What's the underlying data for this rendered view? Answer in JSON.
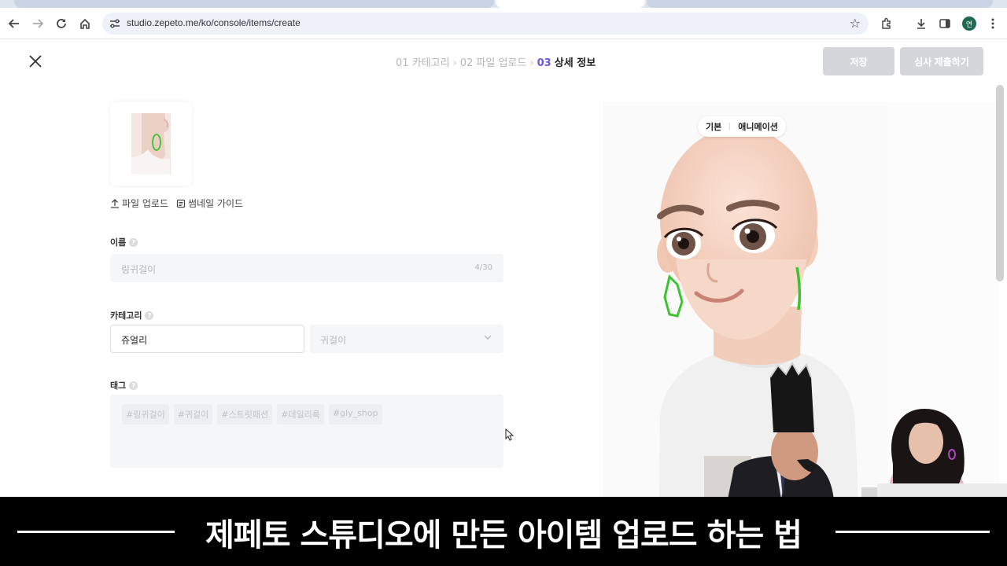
{
  "browser": {
    "url": "studio.zepeto.me/ko/console/items/create",
    "profile_initial": "연"
  },
  "header": {
    "steps": [
      {
        "num": "01",
        "label": "카테고리"
      },
      {
        "num": "02",
        "label": "파일 업로드"
      },
      {
        "num": "03",
        "label": "상세 정보"
      }
    ],
    "save_label": "저장",
    "submit_label": "심사 제출하기"
  },
  "thumbnail": {
    "upload_label": "파일 업로드",
    "guide_label": "썸네일 가이드"
  },
  "form": {
    "name_label": "이름",
    "name_placeholder": "링귀걸이",
    "name_counter": "4/30",
    "category_label": "카테고리",
    "category_value": "쥬얼리",
    "subcategory_placeholder": "귀걸이",
    "tag_label": "태그",
    "tags": [
      "#링귀걸이",
      "#귀걸이",
      "#스트릿패션",
      "#데일리룩",
      "#gly_shop"
    ]
  },
  "preview": {
    "mode_basic": "기본",
    "mode_animation": "애니메이션"
  },
  "caption": {
    "text": "제페토 스튜디오에 만든 아이템 업로드 하는 법"
  },
  "colors": {
    "accent": "#6b58e8",
    "disabled_button": "#d4d6da",
    "earring": "#3fc22f"
  }
}
